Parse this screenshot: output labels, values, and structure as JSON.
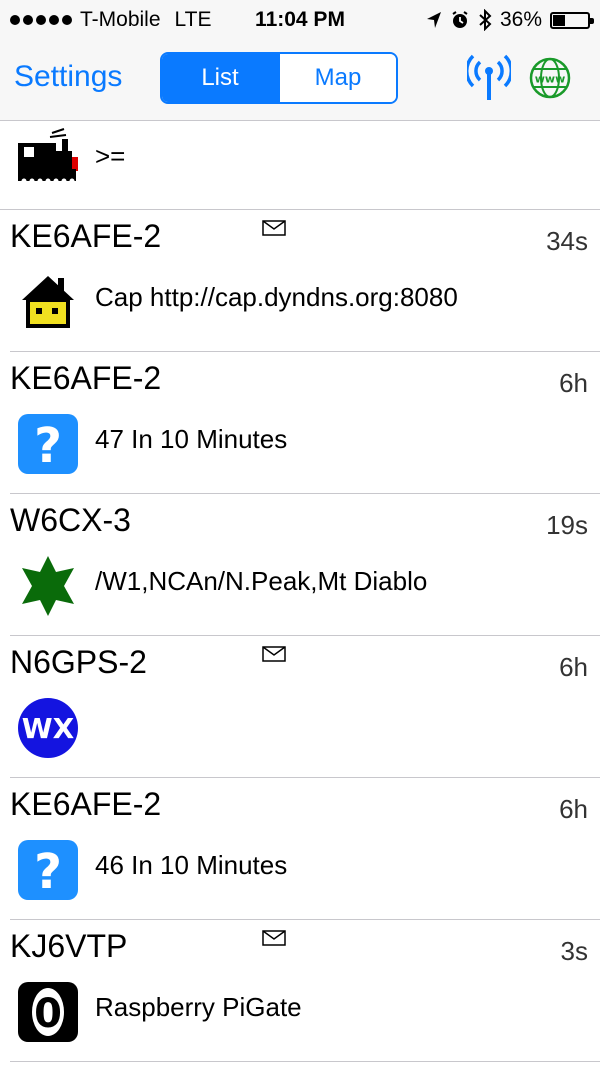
{
  "status": {
    "carrier": "T-Mobile",
    "network": "LTE",
    "time": "11:04 PM",
    "battery_label": "36%",
    "battery_level": 0.36,
    "icons": [
      "location-arrow-icon",
      "alarm-icon",
      "bluetooth-icon",
      "battery-icon"
    ]
  },
  "nav": {
    "settings_label": "Settings",
    "segments": [
      "List",
      "Map"
    ],
    "selected_segment": "List",
    "accent_color": "#0a7aff",
    "right_icons": [
      "antenna-icon",
      "globe-www-icon"
    ],
    "globe_text": "www"
  },
  "first_row": {
    "symbol": "train-icon",
    "comment": ">="
  },
  "stations": [
    {
      "callsign": "KE6AFE-2",
      "age": "34s",
      "has_message": true,
      "symbol": "house-icon",
      "comment": "Cap http://cap.dyndns.org:8080"
    },
    {
      "callsign": "KE6AFE-2",
      "age": "6h",
      "has_message": false,
      "symbol": "question-icon",
      "comment": "47 In 10 Minutes"
    },
    {
      "callsign": "W6CX-3",
      "age": "19s",
      "has_message": false,
      "symbol": "star-icon",
      "comment": "/W1,NCAn/N.Peak,Mt Diablo"
    },
    {
      "callsign": "N6GPS-2",
      "age": "6h",
      "has_message": true,
      "symbol": "wx-icon",
      "symbol_text": "WX",
      "comment": ""
    },
    {
      "callsign": "KE6AFE-2",
      "age": "6h",
      "has_message": false,
      "symbol": "question-icon",
      "comment": "46 In 10 Minutes"
    },
    {
      "callsign": "KJ6VTP",
      "age": "3s",
      "has_message": true,
      "symbol": "digit-zero-icon",
      "symbol_text": "0",
      "comment": "Raspberry PiGate"
    }
  ]
}
